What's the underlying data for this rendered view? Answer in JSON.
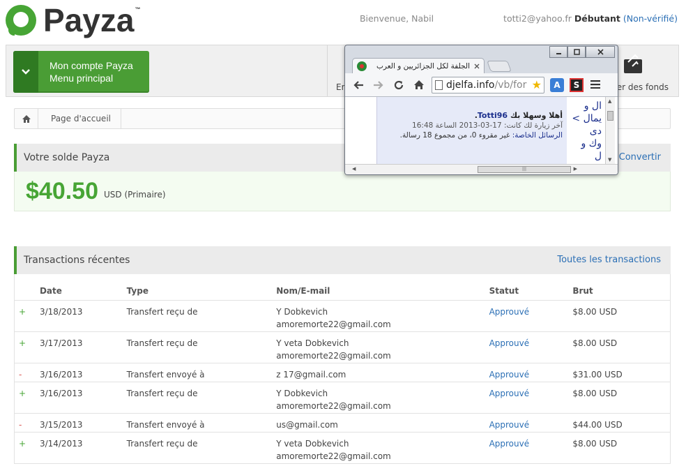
{
  "header": {
    "logo_text": "Payza",
    "logo_tm": "™",
    "greeting": "Bienvenue, Nabil",
    "email": "totti2@yahoo.fr",
    "level": "Débutant",
    "verification": "(Non-vérifié)"
  },
  "menu": {
    "line1": "Mon compte Payza",
    "line2": "Menu principal",
    "chevron": "chevron-down-icon"
  },
  "topnav": {
    "send_label": "En",
    "withdraw_label": "er des fonds"
  },
  "breadcrumb": {
    "home_icon": "home-icon",
    "item": "Page d'accueil"
  },
  "balance": {
    "title": "Votre solde Payza",
    "convert": "Convertir",
    "amount": "$40.50",
    "currency": "USD (Primaire)"
  },
  "transactions": {
    "title": "Transactions récentes",
    "all_link": "Toutes les transactions",
    "columns": [
      "Date",
      "Type",
      "Nom/E-mail",
      "Statut",
      "Brut"
    ],
    "rows": [
      {
        "sign": "+",
        "date": "3/18/2013",
        "type": "Transfert reçu de",
        "name": "Y Dobkevich",
        "email": "amoremorte22@gmail.com",
        "status": "Approuvé",
        "amount": "$8.00 USD"
      },
      {
        "sign": "+",
        "date": "3/17/2013",
        "type": "Transfert reçu de",
        "name": "Y veta Dobkevich",
        "email": "amoremorte22@gmail.com",
        "status": "Approuvé",
        "amount": "$8.00 USD"
      },
      {
        "sign": "-",
        "date": "3/16/2013",
        "type": "Transfert envoyé à",
        "name": "",
        "email": "z 17@gmail.com",
        "status": "Approuvé",
        "amount": "$31.00 USD"
      },
      {
        "sign": "+",
        "date": "3/16/2013",
        "type": "Transfert reçu de",
        "name": "Y Dobkevich",
        "email": "amoremorte22@gmail.com",
        "status": "Approuvé",
        "amount": "$8.00 USD"
      },
      {
        "sign": "-",
        "date": "3/15/2013",
        "type": "Transfert envoyé à",
        "name": "",
        "email": "us@gmail.com",
        "status": "Approuvé",
        "amount": "$44.00 USD"
      },
      {
        "sign": "+",
        "date": "3/14/2013",
        "type": "Transfert reçu de",
        "name": "Y veta Dobkevich",
        "email": "amoremorte22@gmail.com",
        "status": "Approuvé",
        "amount": "$8.00 USD"
      }
    ]
  },
  "browser": {
    "tab_title": "الجلفة لكل الجزائريين و العرب",
    "url_main": "djelfa.info",
    "url_rest": "/vb/for",
    "content": {
      "welcome_prefix": "أهلا وسهلا بك",
      "username": "Totti96",
      "last_visit": "آخر زيارة لك كانت: 17-03-2013 الساعة 16:48",
      "pm_label": "الرسائل الخاصة:",
      "pm_text": "غير مقروء 0، من مجموع 18 رسالة.",
      "side_lines": [
        "ال و",
        "يمال >",
        "دى",
        "وك و",
        "ل"
      ]
    }
  },
  "colors": {
    "brand_green": "#47a535",
    "link_blue": "#2b6fb5",
    "minus_red": "#d9534f"
  }
}
